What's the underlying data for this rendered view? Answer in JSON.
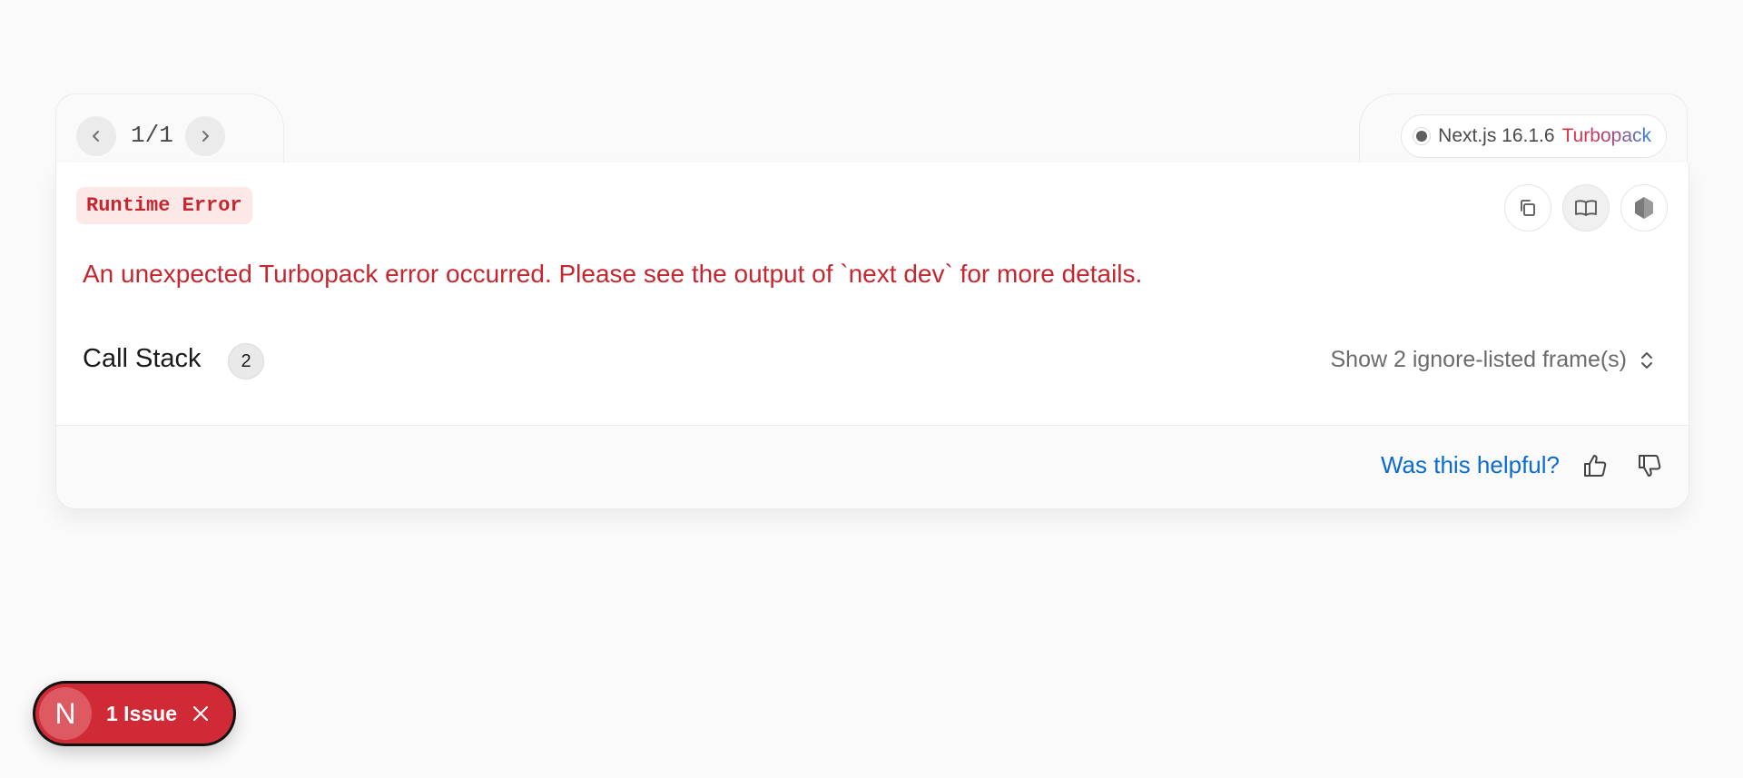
{
  "navigation": {
    "prev_icon": "chevron-left-icon",
    "next_icon": "chevron-right-icon",
    "page_count": "1/1"
  },
  "version": {
    "framework": "Next.js 16.1.6",
    "bundler": "Turbopack"
  },
  "error": {
    "type_label": "Runtime Error",
    "message": "An unexpected Turbopack error occurred. Please see the output of `next dev` for more details."
  },
  "toolbar": {
    "buttons": [
      "copy-icon",
      "book-icon",
      "nodejs-icon"
    ]
  },
  "call_stack": {
    "title": "Call Stack",
    "count": "2",
    "ignore_toggle_label": "Show 2 ignore-listed frame(s)"
  },
  "footer": {
    "helpful_label": "Was this helpful?"
  },
  "issue_indicator": {
    "logo_letter": "N",
    "label": "1 Issue"
  },
  "colors": {
    "error_red": "#c4272f",
    "link_blue": "#0a6bd6",
    "issue_red": "#cf2a35"
  }
}
